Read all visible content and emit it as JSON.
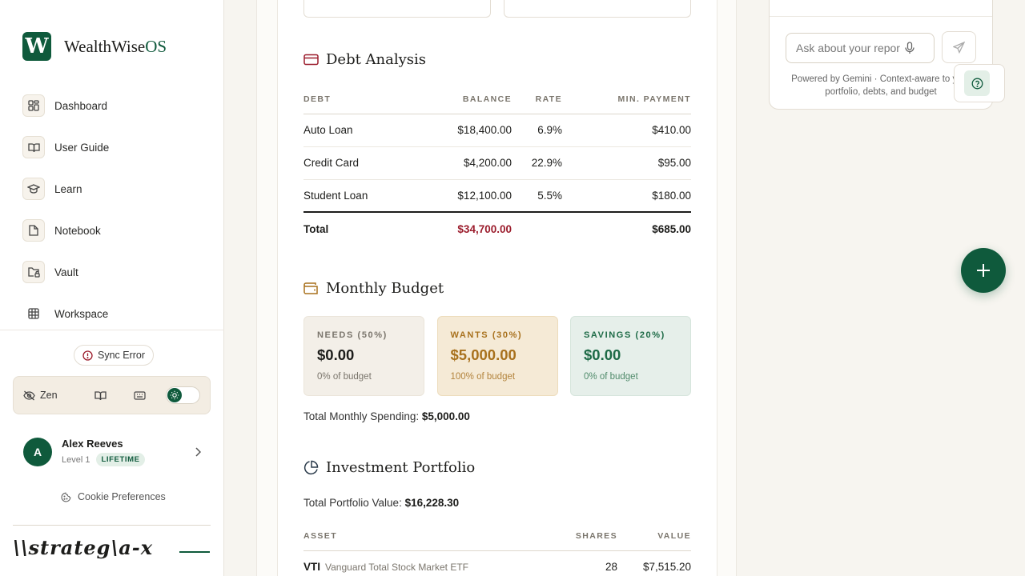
{
  "brand": {
    "logo_letter": "W",
    "name_main": "WealthWise",
    "name_accent": "OS",
    "footer_wordmark": "\\\\strateg\\a-x"
  },
  "sidebar": {
    "items": [
      {
        "label": "Dashboard",
        "icon": "grid-icon"
      },
      {
        "label": "User Guide",
        "icon": "book-open-icon"
      },
      {
        "label": "Learn",
        "icon": "graduation-cap-icon"
      },
      {
        "label": "Notebook",
        "icon": "file-icon"
      },
      {
        "label": "Vault",
        "icon": "folder-lock-icon"
      },
      {
        "label": "Workspace",
        "icon": "table-icon"
      }
    ],
    "sync_status": "Sync Error",
    "zen_label": "Zen",
    "cookie_label": "Cookie Preferences"
  },
  "user": {
    "initial": "A",
    "name": "Alex Reeves",
    "level": "Level 1",
    "badge": "LIFETIME"
  },
  "debt": {
    "title": "Debt Analysis",
    "headers": [
      "DEBT",
      "BALANCE",
      "RATE",
      "MIN. PAYMENT"
    ],
    "rows": [
      {
        "name": "Auto Loan",
        "balance": "$18,400.00",
        "rate": "6.9%",
        "payment": "$410.00"
      },
      {
        "name": "Credit Card",
        "balance": "$4,200.00",
        "rate": "22.9%",
        "payment": "$95.00"
      },
      {
        "name": "Student Loan",
        "balance": "$12,100.00",
        "rate": "5.5%",
        "payment": "$180.00"
      }
    ],
    "total": {
      "label": "Total",
      "balance": "$34,700.00",
      "payment": "$685.00"
    }
  },
  "budget": {
    "title": "Monthly Budget",
    "needs": {
      "label": "NEEDS (50%)",
      "amount": "$0.00",
      "pct": "0% of budget"
    },
    "wants": {
      "label": "WANTS (30%)",
      "amount": "$5,000.00",
      "pct": "100% of budget"
    },
    "savings": {
      "label": "SAVINGS (20%)",
      "amount": "$0.00",
      "pct": "0% of budget"
    },
    "total_label": "Total Monthly Spending:",
    "total_value": "$5,000.00"
  },
  "portfolio": {
    "title": "Investment Portfolio",
    "total_label": "Total Portfolio Value:",
    "total_value": "$16,228.30",
    "headers": [
      "ASSET",
      "SHARES",
      "VALUE"
    ],
    "rows": [
      {
        "ticker": "VTI",
        "name": "Vanguard Total Stock Market ETF",
        "shares": "28",
        "value": "$7,515.20"
      }
    ]
  },
  "chat": {
    "placeholder": "Ask about your report",
    "powered_by": "Powered by Gemini · Context-aware to your portfolio, debts, and budget"
  },
  "colors": {
    "accent": "#0f5a3c",
    "debt_red": "#9b1c2c",
    "wants_amber": "#a8711d"
  }
}
